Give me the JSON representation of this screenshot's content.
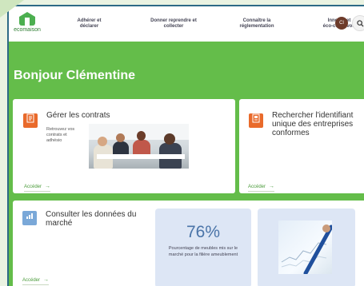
{
  "header": {
    "logo_text": "ecomaison",
    "nav": [
      {
        "line1": "Adhérer et",
        "line2": "déclarer"
      },
      {
        "line1": "Donner reprendre et",
        "line2": "collecter"
      },
      {
        "line1": "Connaître la",
        "line2": "réglementation"
      },
      {
        "line1": "Innover et",
        "line2": "éco-concevoir"
      }
    ],
    "avatar_initials": "Cl",
    "search_icon": "search-icon"
  },
  "greeting": "Bonjour Clémentine",
  "cards": {
    "contrats": {
      "icon": "contract-icon",
      "title": "Gérer les contrats",
      "desc_lines": [
        "Retrouvez vos",
        "contrats et",
        "adhésio"
      ],
      "link": "Accéder"
    },
    "identifiant": {
      "icon": "document-icon",
      "title_lines": [
        "Rechercher l'identifiant",
        "unique des entreprises",
        "conformes"
      ],
      "link": "Accéder"
    },
    "marche": {
      "icon": "chart-icon",
      "title_lines": [
        "Consulter les données du",
        "marché"
      ],
      "link": "Accéder",
      "stat_value": "76%",
      "stat_lines": [
        "Pourcentage de meubles mis sur le",
        "marché pour la filière ameublement"
      ]
    }
  },
  "colors": {
    "brand_green": "#64bd4a",
    "accent_orange": "#e96a2b",
    "accent_blue": "#7aa8d8",
    "link_green": "#4a9b3a"
  }
}
